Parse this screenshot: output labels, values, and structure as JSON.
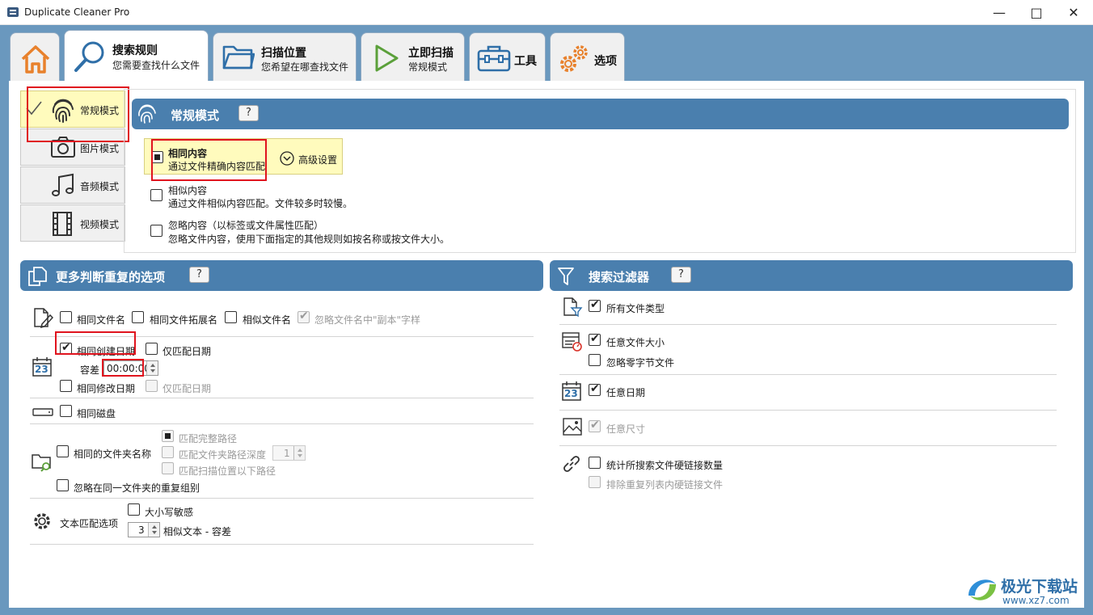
{
  "window": {
    "title": "Duplicate Cleaner Pro"
  },
  "tabs": [
    {
      "title": "",
      "subtitle": "",
      "icon": "home-icon"
    },
    {
      "title": "搜索规则",
      "subtitle": "您需要查找什么文件",
      "icon": "search-icon"
    },
    {
      "title": "扫描位置",
      "subtitle": "您希望在哪查找文件",
      "icon": "folder-icon"
    },
    {
      "title": "立即扫描",
      "subtitle": "常规模式",
      "icon": "play-icon"
    },
    {
      "title": "工具",
      "subtitle": "",
      "icon": "toolbox-icon"
    },
    {
      "title": "选项",
      "subtitle": "",
      "icon": "gears-icon"
    }
  ],
  "modes": [
    {
      "label": "常规模式",
      "icon": "fingerprint-icon",
      "active": true
    },
    {
      "label": "图片模式",
      "icon": "camera-icon"
    },
    {
      "label": "音频模式",
      "icon": "music-icon"
    },
    {
      "label": "视频模式",
      "icon": "film-icon"
    }
  ],
  "normal_mode": {
    "header": "常规模式",
    "help": "?",
    "options": [
      {
        "title": "相同内容",
        "desc": "通过文件精确内容匹配"
      },
      {
        "title": "相似内容",
        "desc": "通过文件相似内容匹配。文件较多时较慢。"
      },
      {
        "title": "忽略内容（以标签或文件属性匹配）",
        "desc": "忽略文件内容，使用下面指定的其他规则如按名称或按文件大小。"
      }
    ],
    "advanced_btn": "高级设置"
  },
  "more_options": {
    "header": "更多判断重复的选项",
    "help": "?",
    "same_filename": "相同文件名",
    "same_ext": "相同文件拓展名",
    "similar_filename": "相似文件名",
    "ignore_copy": "忽略文件名中\"副本\"字样",
    "same_created": "相同创建日期",
    "match_date_only_1": "仅匹配日期",
    "tolerance_label": "容差",
    "tolerance_value": "00:00:00",
    "same_modified": "相同修改日期",
    "match_date_only_2": "仅匹配日期",
    "same_disk": "相同磁盘",
    "same_folder_name": "相同的文件夹名称",
    "match_full_path": "匹配完整路径",
    "match_path_depth": "匹配文件夹路径深度",
    "path_depth_value": "1",
    "match_below_scan": "匹配扫描位置以下路径",
    "ignore_same_folder": "忽略在同一文件夹的重复组别",
    "text_match_label": "文本匹配选项",
    "case_sensitive": "大小写敏感",
    "similar_tolerance_value": "3",
    "similar_tolerance_label": "相似文本 - 容差"
  },
  "filters": {
    "header": "搜索过滤器",
    "help": "?",
    "all_types": "所有文件类型",
    "any_size": "任意文件大小",
    "ignore_zero": "忽略零字节文件",
    "any_date": "任意日期",
    "any_dimension": "任意尺寸",
    "count_hardlinks": "统计所搜索文件硬链接数量",
    "exclude_hardlinks": "排除重复列表内硬链接文件"
  },
  "calendar_day": "23",
  "watermark": {
    "brand": "极光下载站",
    "url": "www.xz7.com"
  }
}
